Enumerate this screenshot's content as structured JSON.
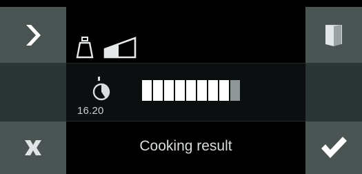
{
  "screen": {
    "timer_value": "16.20",
    "progress": {
      "segments_total": 9,
      "segments_done": 8
    },
    "footer_label": "Cooking result"
  },
  "icons": {
    "next": "chevron-right-icon",
    "cancel": "close-icon",
    "confirm": "checkmark-icon",
    "door": "door-icon",
    "weight": "weight-icon",
    "level": "level-ramp-icon",
    "timer": "timer-icon"
  },
  "colors": {
    "side_button": "#4a5453",
    "side_button_middle": "#2b3533",
    "screen_background": "#000000",
    "progress_done": "#ffffff",
    "progress_pending": "#8e9697"
  }
}
